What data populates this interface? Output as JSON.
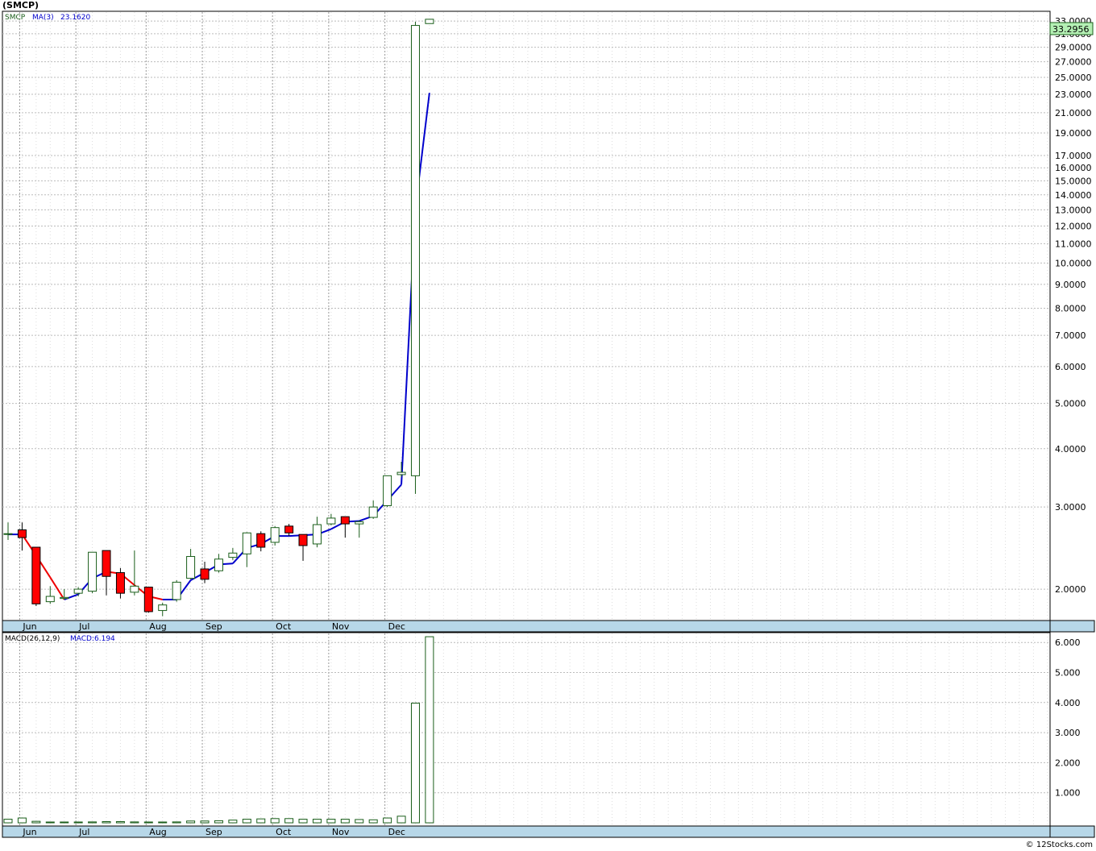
{
  "title": "(SMCP)",
  "copyright": "© 12Stocks.com",
  "price_panel": {
    "legend": {
      "symbol": "SMCP",
      "ma_label": "MA(3)",
      "ma_value": "23.1620"
    },
    "last_price_label": "33.2956",
    "colors": {
      "up": "#1a5e1a",
      "down": "#e00000",
      "down_fill": "#ff0000",
      "ma_up": "#0000cc",
      "ma_down": "#ee0000",
      "badge": "#b4f0b4",
      "axis_band": "#b7d7e8"
    }
  },
  "macd_panel": {
    "legend": {
      "label": "MACD(26,12,9)",
      "value_label": "MACD:6.194"
    }
  },
  "chart_data": [
    {
      "type": "candlestick",
      "scale": "log",
      "ylim": [
        1.72,
        34.5
      ],
      "yticks": [
        2,
        3,
        4,
        5,
        6,
        7,
        8,
        9,
        10,
        11,
        12,
        13,
        14,
        15,
        16,
        17,
        19,
        21,
        23,
        25,
        27,
        29,
        31,
        33
      ],
      "ytick_labels": [
        "2.0000",
        "3.0000",
        "4.0000",
        "5.0000",
        "6.0000",
        "7.0000",
        "8.0000",
        "9.0000",
        "10.0000",
        "11.0000",
        "12.0000",
        "13.0000",
        "14.0000",
        "15.0000",
        "16.0000",
        "17.0000",
        "19.0000",
        "21.0000",
        "23.0000",
        "25.0000",
        "27.0000",
        "29.0000",
        "31.0000",
        "33.0000"
      ],
      "months": [
        "Jun",
        "Jul",
        "Aug",
        "Sep",
        "Oct",
        "Nov",
        "Dec"
      ],
      "month_bar_index": [
        1,
        5,
        10,
        14,
        19,
        23,
        27
      ],
      "candles": [
        {
          "o": 2.63,
          "h": 2.78,
          "l": 2.55,
          "c": 2.63
        },
        {
          "o": 2.68,
          "h": 2.78,
          "l": 2.42,
          "c": 2.58
        },
        {
          "o": 2.46,
          "h": 2.46,
          "l": 1.84,
          "c": 1.86
        },
        {
          "o": 1.88,
          "h": 2.03,
          "l": 1.86,
          "c": 1.93
        },
        {
          "o": 1.91,
          "h": 2.0,
          "l": 1.9,
          "c": 1.92
        },
        {
          "o": 1.96,
          "h": 2.02,
          "l": 1.93,
          "c": 2.0
        },
        {
          "o": 1.98,
          "h": 2.4,
          "l": 1.96,
          "c": 2.4
        },
        {
          "o": 2.42,
          "h": 2.42,
          "l": 1.94,
          "c": 2.13
        },
        {
          "o": 2.17,
          "h": 2.22,
          "l": 1.91,
          "c": 1.96
        },
        {
          "o": 1.97,
          "h": 2.42,
          "l": 1.94,
          "c": 2.03
        },
        {
          "o": 2.02,
          "h": 2.02,
          "l": 1.78,
          "c": 1.79
        },
        {
          "o": 1.8,
          "h": 1.87,
          "l": 1.75,
          "c": 1.85
        },
        {
          "o": 1.9,
          "h": 2.09,
          "l": 1.88,
          "c": 2.07
        },
        {
          "o": 2.11,
          "h": 2.44,
          "l": 2.1,
          "c": 2.35
        },
        {
          "o": 2.21,
          "h": 2.29,
          "l": 2.06,
          "c": 2.1
        },
        {
          "o": 2.19,
          "h": 2.38,
          "l": 2.17,
          "c": 2.32
        },
        {
          "o": 2.34,
          "h": 2.45,
          "l": 2.31,
          "c": 2.39
        },
        {
          "o": 2.38,
          "h": 2.65,
          "l": 2.23,
          "c": 2.64
        },
        {
          "o": 2.63,
          "h": 2.66,
          "l": 2.41,
          "c": 2.46
        },
        {
          "o": 2.52,
          "h": 2.73,
          "l": 2.48,
          "c": 2.71
        },
        {
          "o": 2.73,
          "h": 2.76,
          "l": 2.6,
          "c": 2.64
        },
        {
          "o": 2.62,
          "h": 2.62,
          "l": 2.3,
          "c": 2.48
        },
        {
          "o": 2.5,
          "h": 2.86,
          "l": 2.46,
          "c": 2.75
        },
        {
          "o": 2.76,
          "h": 2.9,
          "l": 2.74,
          "c": 2.84
        },
        {
          "o": 2.86,
          "h": 2.86,
          "l": 2.58,
          "c": 2.76
        },
        {
          "o": 2.76,
          "h": 2.81,
          "l": 2.58,
          "c": 2.79
        },
        {
          "o": 2.85,
          "h": 3.1,
          "l": 2.83,
          "c": 3.0
        },
        {
          "o": 3.02,
          "h": 3.5,
          "l": 3.0,
          "c": 3.5
        },
        {
          "o": 3.52,
          "h": 3.75,
          "l": 3.48,
          "c": 3.56
        },
        {
          "o": 3.5,
          "h": 32.9,
          "l": 3.2,
          "c": 32.3
        },
        {
          "o": 32.6,
          "h": 33.3,
          "l": 32.6,
          "c": 33.3
        }
      ],
      "ma": [
        2.62,
        2.62,
        2.36,
        2.12,
        1.9,
        1.95,
        2.11,
        2.18,
        2.16,
        2.04,
        1.93,
        1.9,
        1.9,
        2.09,
        2.17,
        2.26,
        2.27,
        2.45,
        2.5,
        2.6,
        2.6,
        2.61,
        2.62,
        2.69,
        2.79,
        2.8,
        2.87,
        3.1,
        3.35,
        13.1,
        23.16
      ],
      "ma_last": "23.1620"
    },
    {
      "type": "bar",
      "title": "MACD(26,12,9)",
      "ylim": [
        -0.08,
        6.3
      ],
      "yticks": [
        1,
        2,
        3,
        4,
        5,
        6
      ],
      "ytick_labels": [
        "1.000",
        "2.000",
        "3.000",
        "4.000",
        "5.000",
        "6.000"
      ],
      "values": [
        0.12,
        0.16,
        0.05,
        0.02,
        0.0,
        0.02,
        0.03,
        0.04,
        0.04,
        0.03,
        0.0,
        0.0,
        0.03,
        0.06,
        0.06,
        0.07,
        0.09,
        0.12,
        0.13,
        0.14,
        0.14,
        0.12,
        0.12,
        0.12,
        0.12,
        0.11,
        0.1,
        0.16,
        0.22,
        3.98,
        6.19
      ]
    }
  ]
}
